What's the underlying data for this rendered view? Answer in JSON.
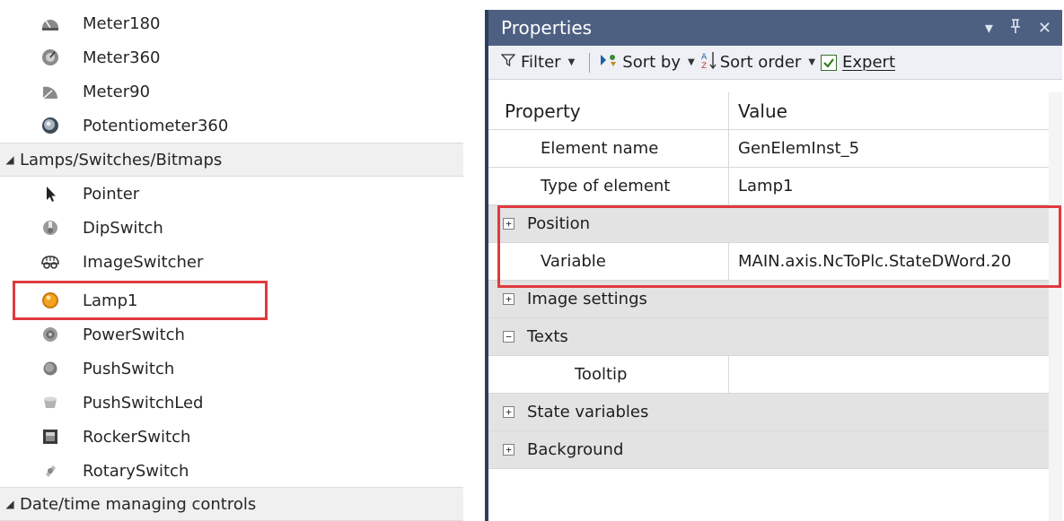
{
  "toolbox": {
    "items": [
      {
        "label": "Meter180",
        "icon": "meter180-icon",
        "kind": "item"
      },
      {
        "label": "Meter360",
        "icon": "meter360-icon",
        "kind": "item"
      },
      {
        "label": "Meter90",
        "icon": "meter90-icon",
        "kind": "item"
      },
      {
        "label": "Potentiometer360",
        "icon": "potentiometer-icon",
        "kind": "item"
      },
      {
        "label": "Lamps/Switches/Bitmaps",
        "icon": "collapse-triangle-icon",
        "kind": "group"
      },
      {
        "label": "Pointer",
        "icon": "pointer-icon",
        "kind": "item"
      },
      {
        "label": "DipSwitch",
        "icon": "dipswitch-icon",
        "kind": "item"
      },
      {
        "label": "ImageSwitcher",
        "icon": "imageswitcher-icon",
        "kind": "item"
      },
      {
        "label": "Lamp1",
        "icon": "lamp-icon",
        "kind": "item"
      },
      {
        "label": "PowerSwitch",
        "icon": "powerswitch-icon",
        "kind": "item"
      },
      {
        "label": "PushSwitch",
        "icon": "pushswitch-icon",
        "kind": "item"
      },
      {
        "label": "PushSwitchLed",
        "icon": "pushswitchled-icon",
        "kind": "item"
      },
      {
        "label": "RockerSwitch",
        "icon": "rockerswitch-icon",
        "kind": "item"
      },
      {
        "label": "RotarySwitch",
        "icon": "rotaryswitch-icon",
        "kind": "item"
      },
      {
        "label": "Date/time managing controls",
        "icon": "collapse-triangle-icon",
        "kind": "group"
      }
    ]
  },
  "properties": {
    "title": "Properties",
    "toolbar": {
      "filter": "Filter",
      "sort_by": "Sort by",
      "sort_order": "Sort order",
      "expert": "Expert",
      "expert_checked": true
    },
    "header": {
      "property": "Property",
      "value": "Value"
    },
    "rows": [
      {
        "property": "Element name",
        "value": "GenElemInst_5",
        "kind": "prop",
        "indent": 1
      },
      {
        "property": "Type of element",
        "value": "Lamp1",
        "kind": "prop",
        "indent": 1
      },
      {
        "property": "Position",
        "value": "",
        "kind": "cat",
        "expander": "+"
      },
      {
        "property": "Variable",
        "value": "MAIN.axis.NcToPlc.StateDWord.20",
        "kind": "prop",
        "indent": 1
      },
      {
        "property": "Image settings",
        "value": "",
        "kind": "cat",
        "expander": "+"
      },
      {
        "property": "Texts",
        "value": "",
        "kind": "cat",
        "expander": "−"
      },
      {
        "property": "Tooltip",
        "value": "",
        "kind": "prop",
        "indent": 2
      },
      {
        "property": "State variables",
        "value": "",
        "kind": "cat",
        "expander": "+"
      },
      {
        "property": "Background",
        "value": "",
        "kind": "cat",
        "expander": "+"
      }
    ]
  },
  "colors": {
    "title_bar": "#4d6082",
    "highlight": "#e03a3e",
    "category_row": "#e3e3e3"
  }
}
